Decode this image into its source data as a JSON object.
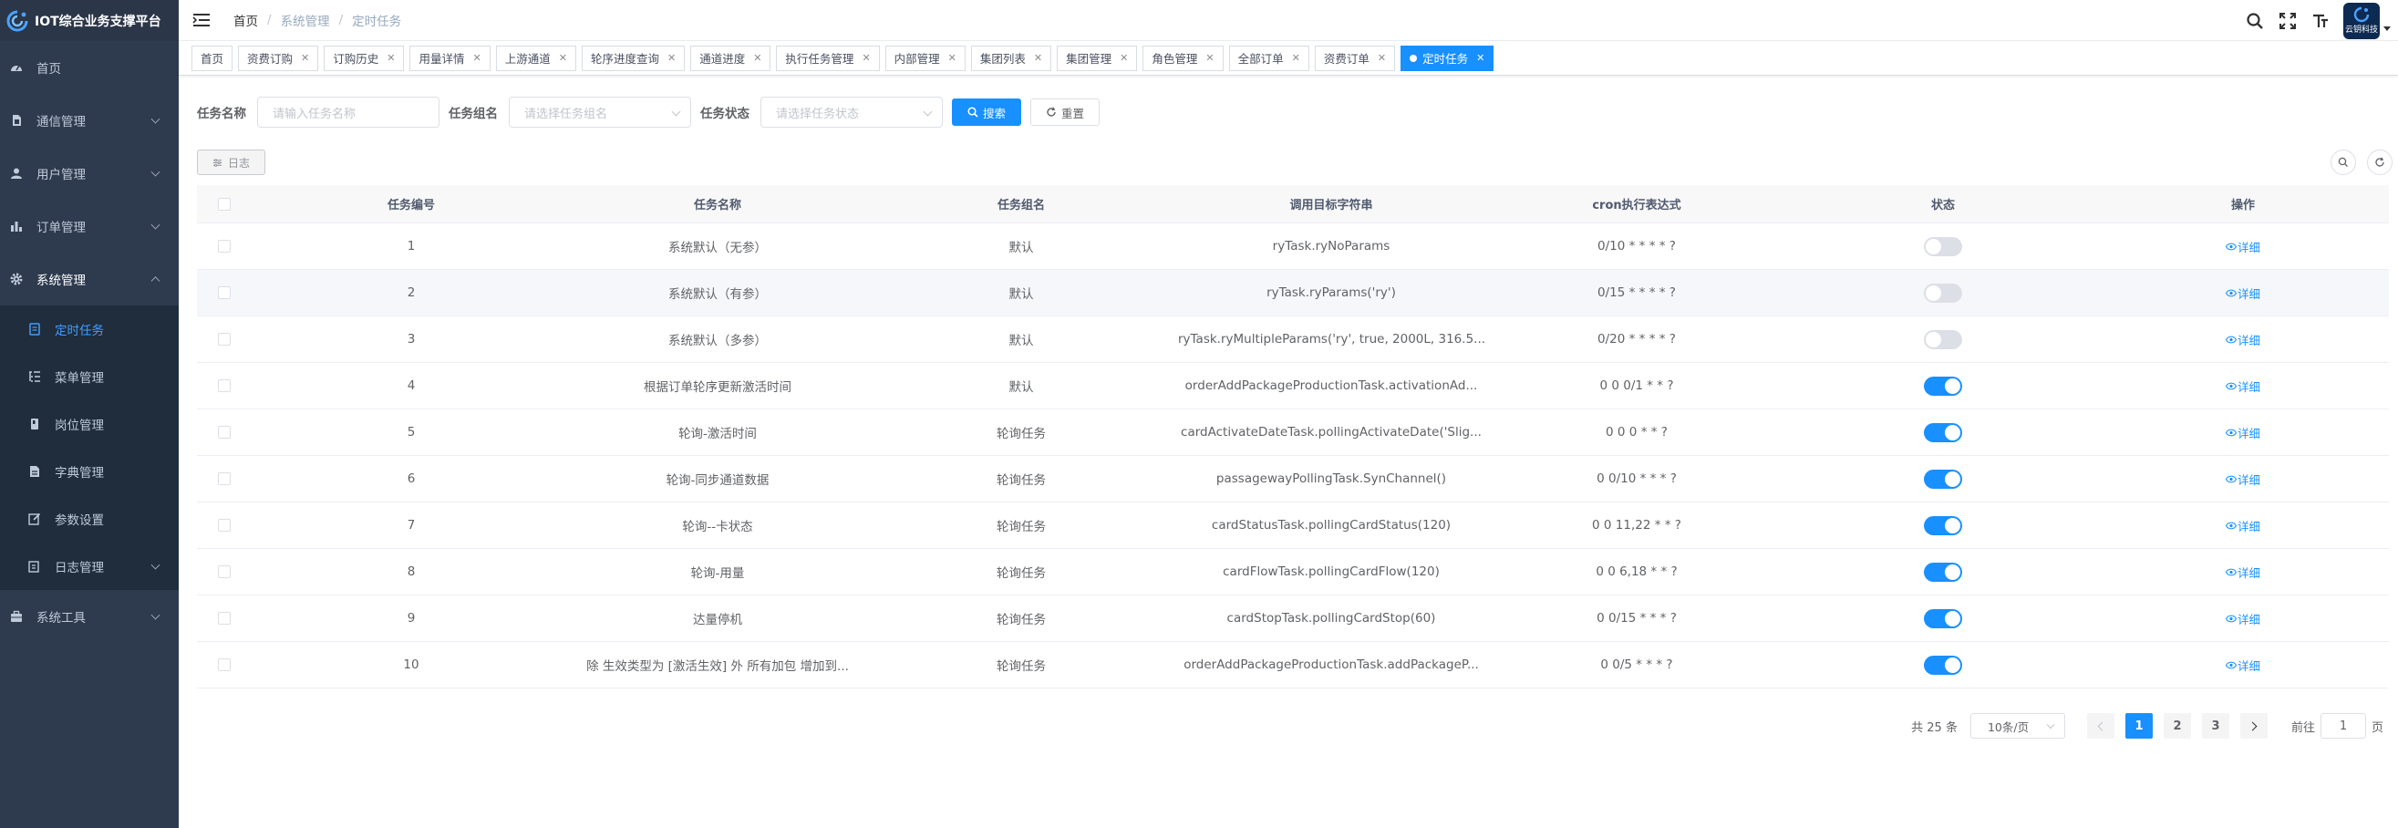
{
  "app": {
    "title": "IOT综合业务支撑平台"
  },
  "sidebar": {
    "items": [
      {
        "label": "首页",
        "icon": "dashboard-icon",
        "has_arrow": false
      },
      {
        "label": "通信管理",
        "icon": "sim-card-icon",
        "has_arrow": true
      },
      {
        "label": "用户管理",
        "icon": "user-icon",
        "has_arrow": true
      },
      {
        "label": "订单管理",
        "icon": "chart-icon",
        "has_arrow": true
      },
      {
        "label": "系统管理",
        "icon": "gear-icon",
        "has_arrow": true,
        "open": true
      }
    ],
    "submenu": [
      {
        "label": "定时任务",
        "icon": "job-icon",
        "active": true
      },
      {
        "label": "菜单管理",
        "icon": "tree-list-icon"
      },
      {
        "label": "岗位管理",
        "icon": "post-icon"
      },
      {
        "label": "字典管理",
        "icon": "dict-icon"
      },
      {
        "label": "参数设置",
        "icon": "edit-icon"
      },
      {
        "label": "日志管理",
        "icon": "log-icon",
        "has_arrow": true
      }
    ],
    "tools": {
      "label": "系统工具",
      "icon": "toolbox-icon"
    }
  },
  "breadcrumb": [
    "首页",
    "系统管理",
    "定时任务"
  ],
  "avatar_text": "云钥科技",
  "tags": [
    {
      "label": "首页",
      "closable": false
    },
    {
      "label": "资费订购",
      "closable": true
    },
    {
      "label": "订购历史",
      "closable": true
    },
    {
      "label": "用量详情",
      "closable": true
    },
    {
      "label": "上游通道",
      "closable": true
    },
    {
      "label": "轮序进度查询",
      "closable": true
    },
    {
      "label": "通道进度",
      "closable": true
    },
    {
      "label": "执行任务管理",
      "closable": true
    },
    {
      "label": "内部管理",
      "closable": true
    },
    {
      "label": "集团列表",
      "closable": true
    },
    {
      "label": "集团管理",
      "closable": true
    },
    {
      "label": "角色管理",
      "closable": true
    },
    {
      "label": "全部订单",
      "closable": true
    },
    {
      "label": "资费订单",
      "closable": true
    },
    {
      "label": "定时任务",
      "closable": true,
      "active": true
    }
  ],
  "search": {
    "task_name_label": "任务名称",
    "task_name_placeholder": "请输入任务名称",
    "task_group_label": "任务组名",
    "task_group_placeholder": "请选择任务组名",
    "task_status_label": "任务状态",
    "task_status_placeholder": "请选择任务状态",
    "search_button": "搜索",
    "reset_button": "重置"
  },
  "toolbar": {
    "log_button": "日志"
  },
  "table": {
    "columns": [
      "任务编号",
      "任务名称",
      "任务组名",
      "调用目标字符串",
      "cron执行表达式",
      "状态",
      "操作"
    ],
    "action_label": "详细",
    "rows": [
      {
        "id": "1",
        "name": "系统默认（无参）",
        "group": "默认",
        "target": "ryTask.ryNoParams",
        "cron": "0/10 * * * * ?",
        "enabled": false
      },
      {
        "id": "2",
        "name": "系统默认（有参）",
        "group": "默认",
        "target": "ryTask.ryParams('ry')",
        "cron": "0/15 * * * * ?",
        "enabled": false
      },
      {
        "id": "3",
        "name": "系统默认（多参）",
        "group": "默认",
        "target": "ryTask.ryMultipleParams('ry', true, 2000L, 316.5...",
        "cron": "0/20 * * * * ?",
        "enabled": false
      },
      {
        "id": "4",
        "name": "根据订单轮序更新激活时间",
        "group": "默认",
        "target": "orderAddPackageProductionTask.activationAd...",
        "cron": "0 0 0/1 * * ?",
        "enabled": true
      },
      {
        "id": "5",
        "name": "轮询-激活时间",
        "group": "轮询任务",
        "target": "cardActivateDateTask.pollingActivateDate('Slig...",
        "cron": "0 0 0 * * ?",
        "enabled": true
      },
      {
        "id": "6",
        "name": "轮询-同步通道数据",
        "group": "轮询任务",
        "target": "passagewayPollingTask.SynChannel()",
        "cron": "0 0/10 * * * ?",
        "enabled": true
      },
      {
        "id": "7",
        "name": "轮询--卡状态",
        "group": "轮询任务",
        "target": "cardStatusTask.pollingCardStatus(120)",
        "cron": "0 0 11,22 * * ?",
        "enabled": true
      },
      {
        "id": "8",
        "name": "轮询-用量",
        "group": "轮询任务",
        "target": "cardFlowTask.pollingCardFlow(120)",
        "cron": "0 0 6,18 * * ?",
        "enabled": true
      },
      {
        "id": "9",
        "name": "达量停机",
        "group": "轮询任务",
        "target": "cardStopTask.pollingCardStop(60)",
        "cron": "0 0/15 * * * ?",
        "enabled": true
      },
      {
        "id": "10",
        "name": "除 生效类型为 [激活生效] 外 所有加包 增加到...",
        "group": "轮询任务",
        "target": "orderAddPackageProductionTask.addPackageP...",
        "cron": "0 0/5 * * * ?",
        "enabled": true
      }
    ]
  },
  "pagination": {
    "total_text": "共 25 条",
    "page_size": "10条/页",
    "pages": [
      "1",
      "2",
      "3"
    ],
    "current": "1",
    "goto_label": "前往",
    "goto_value": "1",
    "goto_suffix": "页"
  },
  "colors": {
    "primary": "#1890ff",
    "sidebar_bg": "#2e3a4e",
    "submenu_bg": "#1f2d3d"
  }
}
